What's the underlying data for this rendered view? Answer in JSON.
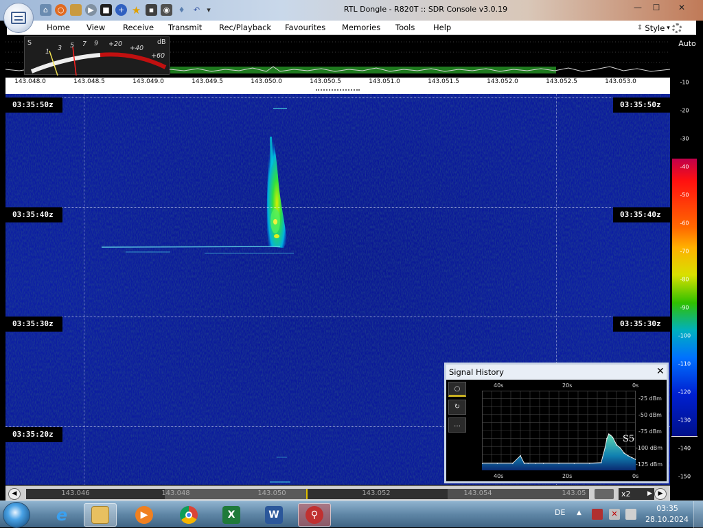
{
  "window": {
    "title": "RTL Dongle - R820T :: SDR Console v3.0.19",
    "minimize": "—",
    "maximize": "☐",
    "close": "✕"
  },
  "quick_access": [
    "home-icon",
    "lifebuoy-icon",
    "folder-icon",
    "play-icon",
    "stop-icon",
    "add-icon",
    "star-icon",
    "lock-icon",
    "camera-icon",
    "drop-icon",
    "undo-icon",
    "dropdown-icon"
  ],
  "menu": {
    "items": [
      "Home",
      "View",
      "Receive",
      "Transmit",
      "Rec/Playback",
      "Favourites",
      "Memories",
      "Tools",
      "Help"
    ],
    "style_label": "Style"
  },
  "smeter": {
    "s_label": "S",
    "db_label": "dB",
    "s_ticks": [
      "1",
      "3",
      "5",
      "7",
      "9"
    ],
    "db_ticks": [
      "+20",
      "+40",
      "+60"
    ]
  },
  "frequency_scale": [
    "143.048.0",
    "143.048.5",
    "143.049.0",
    "143.049.5",
    "143.050.0",
    "143.050.5",
    "143.051.0",
    "143.051.5",
    "143.052.0",
    "143.052.5",
    "143.053.0"
  ],
  "waterfall": {
    "time_labels": [
      "03:35:50z",
      "03:35:40z",
      "03:35:30z",
      "03:35:20z"
    ]
  },
  "db_scale": {
    "auto_label": "Auto",
    "values": [
      "-10",
      "-20",
      "-30",
      "-40",
      "-50",
      "-60",
      "-70",
      "-80",
      "-90",
      "-100",
      "-110",
      "-120",
      "-130",
      "-140",
      "-150"
    ]
  },
  "bottom_bar": {
    "frequencies": [
      "143.046",
      "143.048",
      "143.050",
      "143.052",
      "143.054",
      "143.05"
    ],
    "zoom": "x2"
  },
  "signal_history": {
    "title": "Signal History",
    "close": "✕",
    "tools": [
      "○",
      "↻",
      "…"
    ],
    "time_axis": [
      "40s",
      "20s",
      "0s"
    ],
    "level_axis": [
      "-25 dBm",
      "-50 dBm",
      "-75 dBm",
      "-100 dBm",
      "-125 dBm"
    ],
    "s_reading": "S5",
    "chart_data": {
      "type": "area",
      "x": [
        40,
        36,
        32,
        30,
        29,
        28,
        26,
        24,
        20,
        16,
        12,
        9,
        8,
        7.5,
        7,
        6.5,
        6,
        5,
        4,
        3,
        2,
        1,
        0
      ],
      "y": [
        -124,
        -124,
        -124,
        -112,
        -124,
        -124,
        -124,
        -124,
        -124,
        -124,
        -124,
        -123,
        -100,
        -85,
        -78,
        -80,
        -83,
        -95,
        -100,
        -108,
        -112,
        -115,
        -118
      ],
      "xlabel": "",
      "ylabel": "",
      "xlim": [
        40,
        0
      ],
      "ylim": [
        -135,
        -10
      ],
      "grid": true
    }
  },
  "taskbar": {
    "apps": [
      "internet-explorer-icon",
      "file-explorer-icon",
      "media-player-icon",
      "chrome-icon",
      "excel-icon",
      "word-icon",
      "sdr-console-icon"
    ],
    "language": "DE",
    "time": "03:35",
    "date": "28.10.2024"
  },
  "colors": {
    "waterfall_bg": "#0c1ea4",
    "signal_core": "#30e040",
    "signal_edge": "#00b0e0",
    "titlebar_text": "#000000",
    "meter_red": "#c01010"
  }
}
